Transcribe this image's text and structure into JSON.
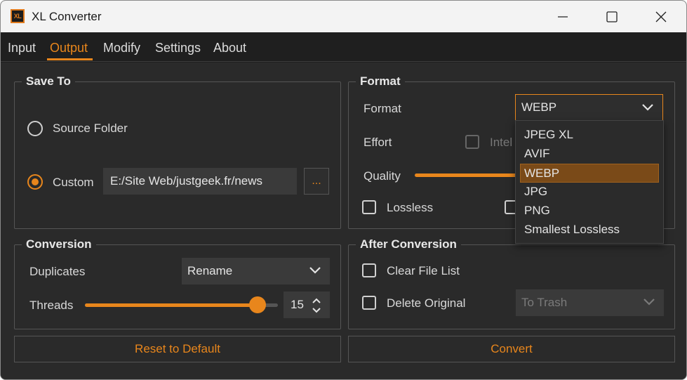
{
  "app": {
    "title": "XL Converter",
    "logo_text": "XL"
  },
  "window_controls": {
    "minimize": "minimize",
    "maximize": "maximize",
    "close": "close"
  },
  "tabs": [
    {
      "label": "Input",
      "active": false
    },
    {
      "label": "Output",
      "active": true
    },
    {
      "label": "Modify",
      "active": false
    },
    {
      "label": "Settings",
      "active": false
    },
    {
      "label": "About",
      "active": false
    }
  ],
  "save_to": {
    "title": "Save To",
    "source_folder_label": "Source Folder",
    "custom_label": "Custom",
    "selected": "Custom",
    "custom_path": "E:/Site Web/justgeek.fr/news",
    "browse_label": "..."
  },
  "format": {
    "title": "Format",
    "format_label": "Format",
    "format_value": "WEBP",
    "effort_label": "Effort",
    "intelligent_label": "Intel",
    "quality_label": "Quality",
    "lossless_label": "Lossless",
    "options": [
      "JPEG XL",
      "AVIF",
      "WEBP",
      "JPG",
      "PNG",
      "Smallest Lossless"
    ],
    "selected_option": "WEBP"
  },
  "conversion": {
    "title": "Conversion",
    "duplicates_label": "Duplicates",
    "duplicates_value": "Rename",
    "threads_label": "Threads",
    "threads_value": "15"
  },
  "after_conversion": {
    "title": "After Conversion",
    "clear_file_list_label": "Clear File List",
    "delete_original_label": "Delete Original",
    "delete_mode_value": "To Trash"
  },
  "actions": {
    "reset_label": "Reset to Default",
    "convert_label": "Convert"
  },
  "colors": {
    "accent": "#e8861c",
    "background": "#2a2a2a",
    "field": "#3a3a3a"
  }
}
